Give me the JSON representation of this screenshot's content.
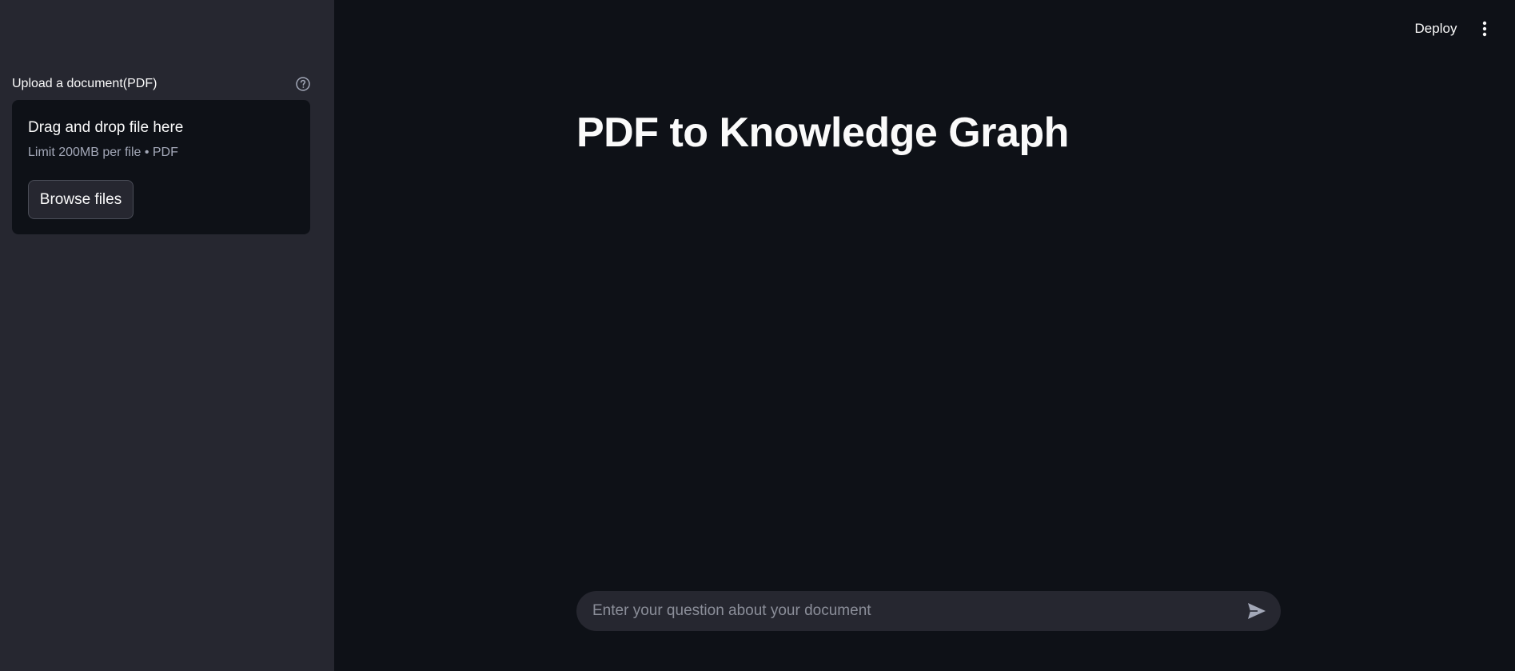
{
  "sidebar": {
    "upload_label": "Upload a document(PDF)",
    "help_icon": "question-circle-icon",
    "dropzone": {
      "title": "Drag and drop file here",
      "limit": "Limit 200MB per file • PDF",
      "browse_label": "Browse files"
    }
  },
  "header": {
    "deploy_label": "Deploy",
    "menu_icon": "vertical-ellipsis-icon"
  },
  "main": {
    "title": "PDF to Knowledge Graph"
  },
  "chat": {
    "placeholder": "Enter your question about your document",
    "value": "",
    "send_icon": "send-arrow-icon"
  },
  "colors": {
    "main_bg": "#0e1117",
    "sidebar_bg": "#262730",
    "text": "#fafafa",
    "muted_text": "#a3a8b8"
  }
}
